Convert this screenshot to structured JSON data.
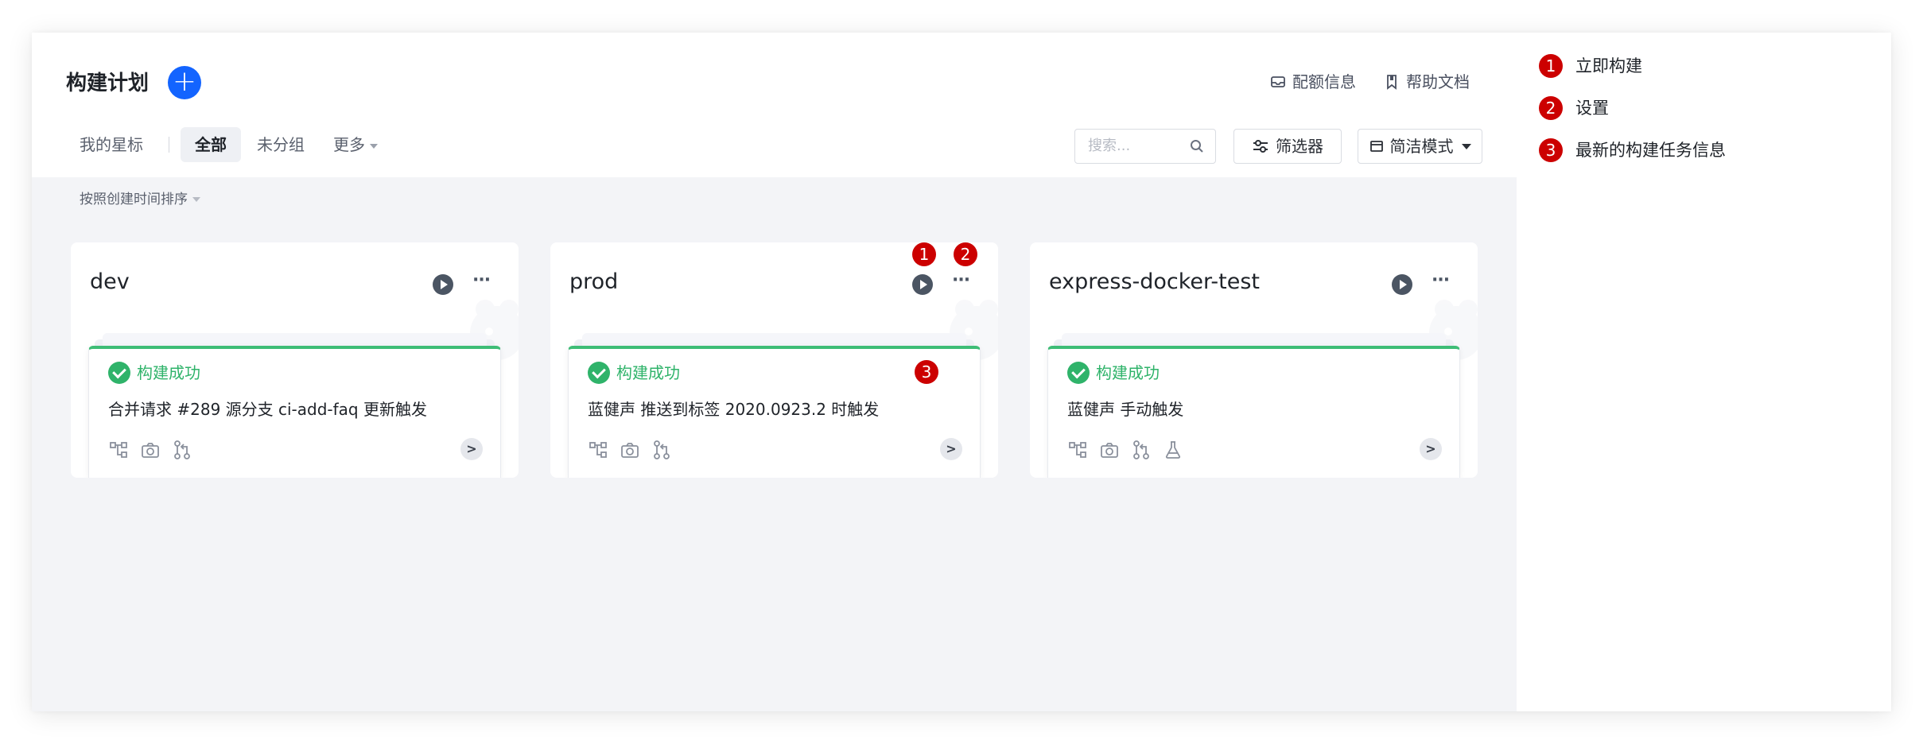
{
  "header": {
    "title": "构建计划",
    "links": [
      {
        "label": "配额信息",
        "icon": "inbox-icon"
      },
      {
        "label": "帮助文档",
        "icon": "bookmark-icon"
      }
    ]
  },
  "tabs": {
    "starred": "我的星标",
    "all": "全部",
    "ungrouped": "未分组",
    "more": "更多"
  },
  "toolbar": {
    "search_placeholder": "搜索...",
    "filter_label": "筛选器",
    "mode_label": "简洁模式"
  },
  "sort_label": "按照创建时间排序",
  "cards": [
    {
      "name": "dev",
      "status": "构建成功",
      "description": "合并请求 #289 源分支 ci-add-faq 更新触发",
      "meta_icons": [
        "pipeline-icon",
        "camera-icon",
        "merge-request-icon"
      ]
    },
    {
      "name": "prod",
      "status": "构建成功",
      "description": "蓝健声 推送到标签 2020.0923.2 时触发",
      "meta_icons": [
        "pipeline-icon",
        "camera-icon",
        "merge-request-icon"
      ]
    },
    {
      "name": "express-docker-test",
      "status": "构建成功",
      "description": "蓝健声 手动触发",
      "meta_icons": [
        "pipeline-icon",
        "camera-icon",
        "merge-request-icon",
        "flask-icon"
      ]
    }
  ],
  "annotations": {
    "badges": [
      "1",
      "2",
      "3"
    ],
    "legend": [
      {
        "num": "1",
        "text": "立即构建"
      },
      {
        "num": "2",
        "text": "设置"
      },
      {
        "num": "3",
        "text": "最新的构建任务信息"
      }
    ]
  },
  "colors": {
    "primary": "#1364ff",
    "success": "#2fb36a",
    "annotation": "#cc0000",
    "background": "#f3f4f7"
  }
}
